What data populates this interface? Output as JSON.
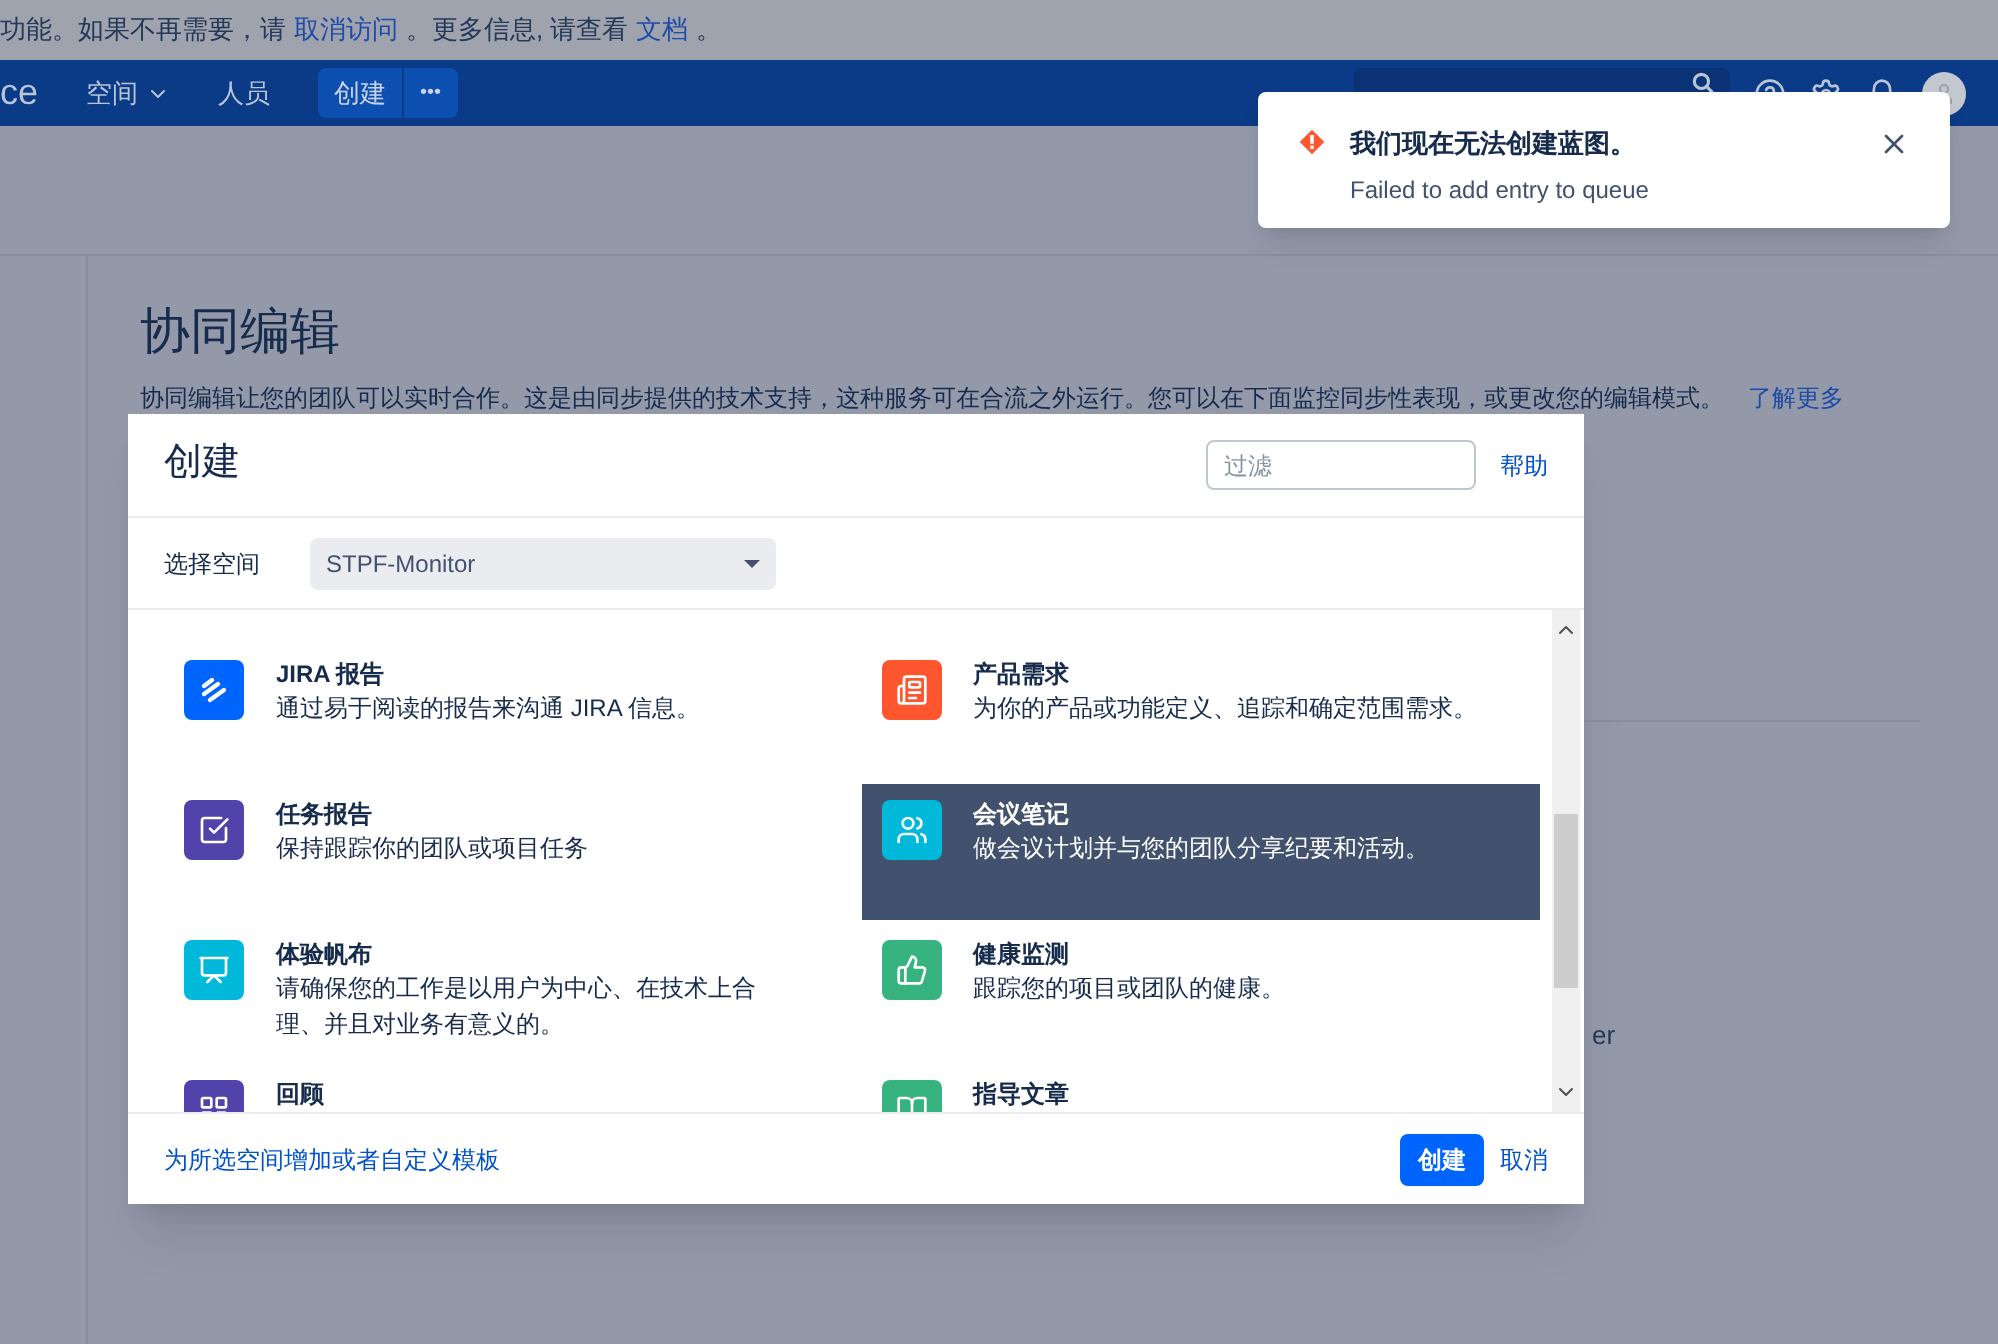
{
  "banner": {
    "parts": [
      {
        "kind": "text",
        "text": "功能。如果不再需要，请"
      },
      {
        "kind": "link",
        "text": "取消访问"
      },
      {
        "kind": "text",
        "text": "。更多信息, 请查看"
      },
      {
        "kind": "link",
        "text": "文档"
      },
      {
        "kind": "text",
        "text": "。"
      }
    ]
  },
  "nav": {
    "logo_fragment": "ce",
    "items": [
      {
        "label": "空间",
        "dropdown": true
      },
      {
        "label": "人员",
        "dropdown": false
      }
    ],
    "create_button": "创建",
    "more_button": "•••"
  },
  "page": {
    "title": "协同编辑",
    "intro": "协同编辑让您的团队可以实时合作。这是由同步提供的技术支持，这种服务可在合流之外运行。您可以在下面监控同步性表现，或更改您的编辑模式。",
    "intro_link": "了解更多",
    "fragment": "er"
  },
  "toast": {
    "title": "我们现在无法创建蓝图。",
    "message": "Failed to add entry to queue"
  },
  "dialog": {
    "title": "创建",
    "filter": {
      "placeholder": "过滤"
    },
    "help": "帮助",
    "space_label": "选择空间",
    "space_value": "STPF-Monitor",
    "templates": [
      {
        "kind": "jira",
        "title": "JIRA 报告",
        "description": "通过易于阅读的报告来沟通 JIRA 信息。",
        "color": "#0065ff",
        "selected": false
      },
      {
        "kind": "requirements",
        "title": "产品需求",
        "description": "为你的产品或功能定义、追踪和确定范围需求。",
        "color": "#ff5630",
        "selected": false
      },
      {
        "kind": "task",
        "title": "任务报告",
        "description": "保持跟踪你的团队或项目任务",
        "color": "#5243aa",
        "selected": false
      },
      {
        "kind": "meeting",
        "title": "会议笔记",
        "description": "做会议计划并与您的团队分享纪要和活动。",
        "color": "#00b8d9",
        "selected": true
      },
      {
        "kind": "canvas",
        "title": "体验帆布",
        "description": "请确保您的工作是以用户为中心、在技术上合理、并且对业务有意义的。",
        "color": "#00b8d9",
        "selected": false
      },
      {
        "kind": "health",
        "title": "健康监测",
        "description": "跟踪您的项目或团队的健康。",
        "color": "#36b37e",
        "selected": false
      },
      {
        "kind": "retro",
        "title": "回顾",
        "color": "#5243aa",
        "selected": false
      },
      {
        "kind": "guide",
        "title": "指导文章",
        "color": "#36b37e",
        "selected": false
      }
    ],
    "footer_link": "为所选空间增加或者自定义模板",
    "create": "创建",
    "cancel": "取消"
  }
}
